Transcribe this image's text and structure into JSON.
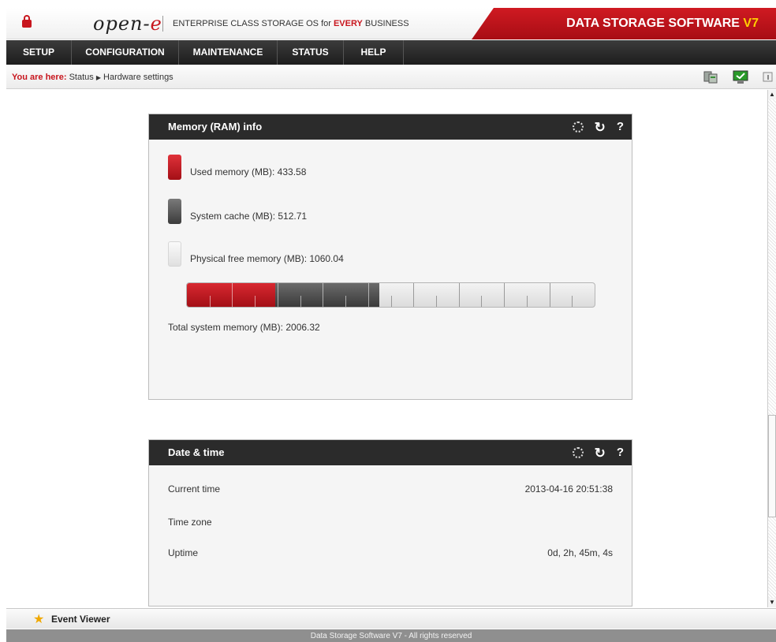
{
  "header": {
    "brand_prefix": "open-",
    "brand_suffix": "e",
    "tagline_pre": "ENTERPRISE CLASS STORAGE OS for ",
    "tagline_hl": "EVERY",
    "tagline_post": " BUSINESS",
    "product": "DATA STORAGE SOFTWARE ",
    "version": "V7"
  },
  "menu": {
    "setup": "SETUP",
    "configuration": "CONFIGURATION",
    "maintenance": "MAINTENANCE",
    "status": "STATUS",
    "help": "HELP"
  },
  "breadcrumb": {
    "label": "You are here:",
    "path_1": "Status",
    "path_2": "Hardware settings"
  },
  "memory_panel": {
    "title": "Memory (RAM) info",
    "used_label": "Used memory (MB): 433.58",
    "cache_label": "System cache (MB): 512.71",
    "free_label": "Physical free memory (MB): 1060.04",
    "total_label": "Total system memory (MB): 2006.32",
    "used_mb": 433.58,
    "cache_mb": 512.71,
    "free_mb": 1060.04,
    "total_mb": 2006.32
  },
  "datetime_panel": {
    "title": "Date & time",
    "current_time_label": "Current time",
    "current_time_value": "2013-04-16 20:51:38",
    "timezone_label": "Time zone",
    "timezone_value": "",
    "uptime_label": "Uptime",
    "uptime_value": "0d, 2h, 45m, 4s"
  },
  "footer": {
    "event_viewer": "Event Viewer",
    "copyright": "Data Storage Software V7 - All rights reserved"
  },
  "colors": {
    "accent_red": "#c8161e",
    "menubar": "#2b2b2b"
  }
}
